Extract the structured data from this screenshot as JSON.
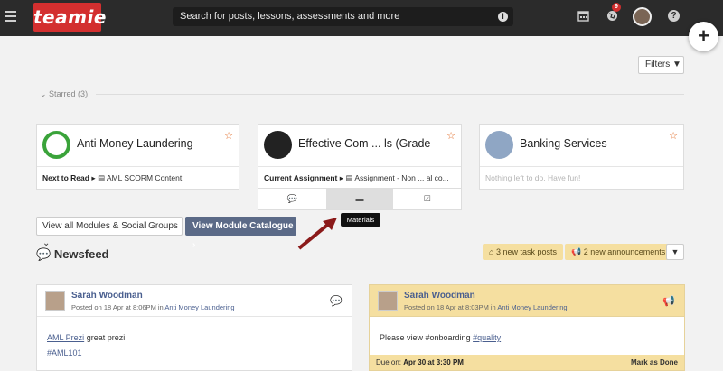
{
  "topbar": {
    "logo_text": "teamie",
    "search_placeholder": "Search for posts, lessons, assessments and more",
    "notification_count": "9",
    "icons": [
      "menu-icon",
      "calendar-icon",
      "globe-icon",
      "user-avatar",
      "help-icon",
      "plus-icon"
    ]
  },
  "filters_label": "Filters",
  "starred": {
    "label": "Starred (3)"
  },
  "cards": [
    {
      "title": "Anti Money Laundering",
      "footer_label": "Next to Read",
      "footer_value": "AML SCORM Content"
    },
    {
      "title": "Effective Com ... ls (Grade",
      "footer_label": "Current Assignment",
      "footer_value": "Assignment - Non ... al co..."
    },
    {
      "title": "Banking Services",
      "footer_value": "Nothing left to do. Have fun!"
    }
  ],
  "tooltip": "Materials",
  "view_all_label": "View all Modules & Social Groups",
  "catalogue_label": "View Module Catalogue",
  "newsfeed": {
    "title": "Newsfeed",
    "task_posts": "3 new task posts",
    "announcements": "2 new announcements"
  },
  "posts": [
    {
      "author": "Sarah Woodman",
      "meta_prefix": "Posted on 18 Apr at 8:06PM in",
      "group": "Anti Money Laundering",
      "link1": "AML Prezi",
      "text1": "great prezi",
      "tag": "#AML101"
    },
    {
      "author": "Sarah Woodman",
      "meta_prefix": "Posted on 18 Apr at 8:03PM in",
      "group": "Anti Money Laundering",
      "text1": "Please view #onboarding",
      "tag": "#quality",
      "due_label": "Due on:",
      "due_value": "Apr 30 at 3:30 PM",
      "mark_done": "Mark as Done"
    }
  ],
  "colors": {
    "topbar": "#2b2b2b",
    "logo": "#d32f2f",
    "catalogue": "#5b6a87",
    "announcement": "#f5dfa0",
    "star": "#e0651e"
  }
}
